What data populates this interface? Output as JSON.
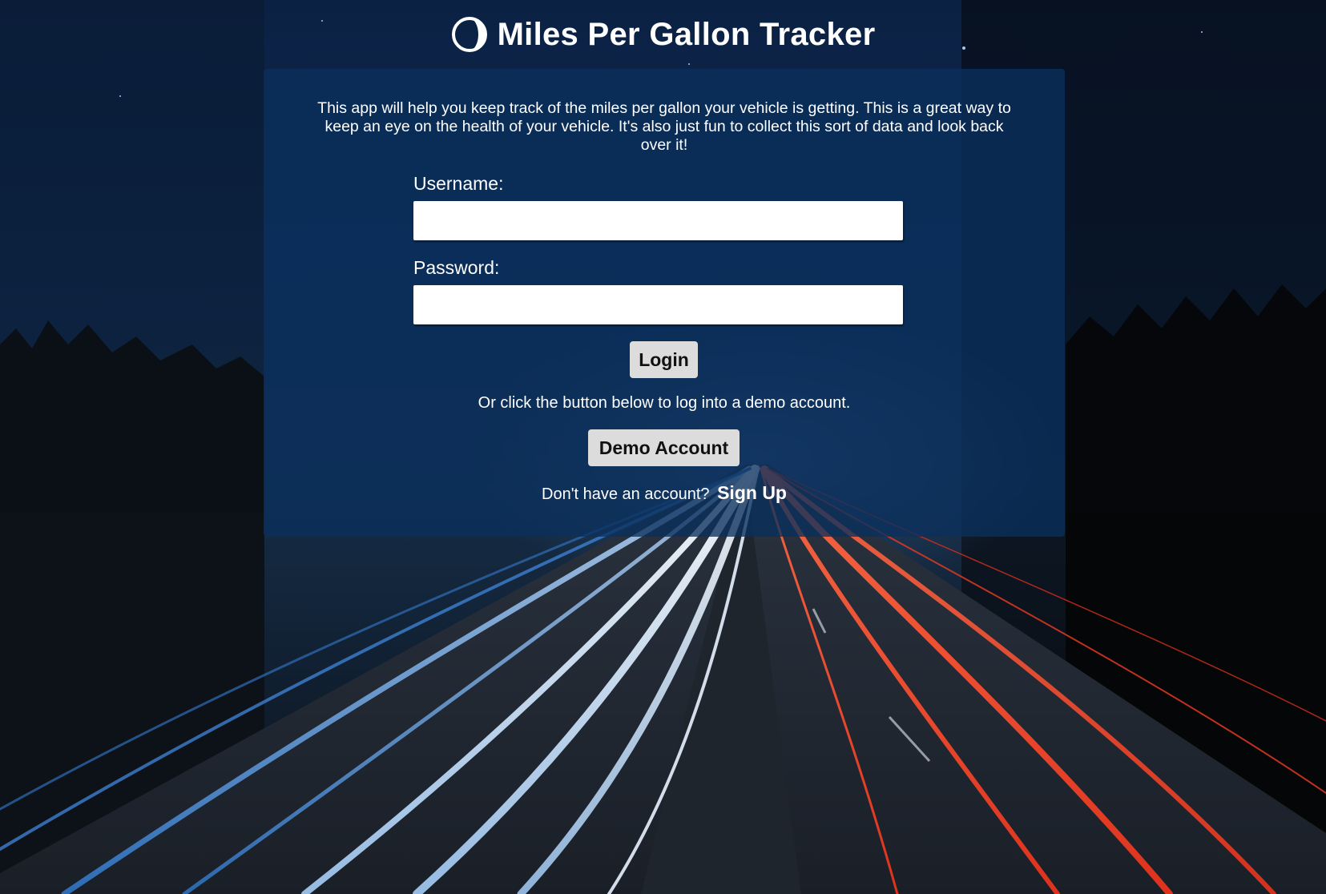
{
  "app": {
    "title": "Miles Per Gallon Tracker",
    "logo_icon": "half-circle-logo-icon"
  },
  "intro": {
    "text": "This app will help you keep track of the miles per gallon your vehicle is getting. This is a great way to keep an eye on the health of your vehicle. It's also just fun to collect this sort of data and look back over it!"
  },
  "login_form": {
    "username_label": "Username:",
    "username_value": "",
    "password_label": "Password:",
    "password_value": "",
    "login_button": "Login"
  },
  "demo": {
    "prompt": "Or click the button below to log into a demo account.",
    "button": "Demo Account"
  },
  "signup": {
    "prompt": "Don't have an account?",
    "link": "Sign Up"
  },
  "colors": {
    "panel": "#0a305c",
    "button": "#dcdcdc",
    "text": "#ffffff"
  },
  "background": {
    "description_icon": "highway-light-trails-photo"
  }
}
